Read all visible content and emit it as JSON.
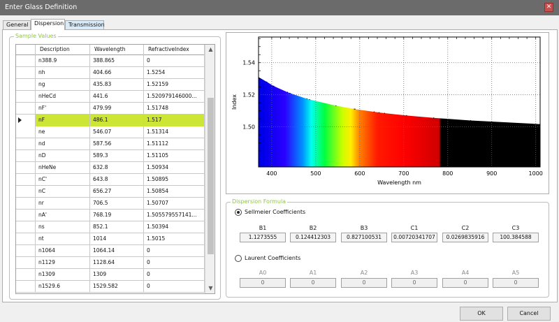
{
  "window": {
    "title": "Enter Glass Definition",
    "close_glyph": "✕"
  },
  "tabs": [
    {
      "label": "General"
    },
    {
      "label": "Dispersion"
    },
    {
      "label": "Transmission"
    }
  ],
  "sample_values": {
    "group_label": "Sample Values",
    "columns": [
      "Description",
      "Wavelength",
      "RefractiveIndex"
    ],
    "rows": [
      [
        "n388.9",
        "388.865",
        "0"
      ],
      [
        "nh",
        "404.66",
        "1.5254"
      ],
      [
        "ng",
        "435.83",
        "1.52159"
      ],
      [
        "nHeCd",
        "441.6",
        "1.520979146000..."
      ],
      [
        "nF'",
        "479.99",
        "1.51748"
      ],
      [
        "nF",
        "486.1",
        "1.517"
      ],
      [
        "ne",
        "546.07",
        "1.51314"
      ],
      [
        "nd",
        "587.56",
        "1.51112"
      ],
      [
        "nD",
        "589.3",
        "1.51105"
      ],
      [
        "nHeNe",
        "632.8",
        "1.50934"
      ],
      [
        "nC'",
        "643.8",
        "1.50895"
      ],
      [
        "nC",
        "656.27",
        "1.50854"
      ],
      [
        "nr",
        "706.5",
        "1.50707"
      ],
      [
        "nA'",
        "768.19",
        "1.505579557141..."
      ],
      [
        "ns",
        "852.1",
        "1.50394"
      ],
      [
        "nt",
        "1014",
        "1.5015"
      ],
      [
        "n1064",
        "1064.14",
        "0"
      ],
      [
        "n1129",
        "1128.64",
        "0"
      ],
      [
        "n1309",
        "1309",
        "0"
      ],
      [
        "n1529.6",
        "1529.582",
        "0"
      ]
    ],
    "selected_row": 5
  },
  "chart_data": {
    "type": "line",
    "xlabel": "Wavelength nm",
    "ylabel": "Index",
    "xlim": [
      370,
      1010
    ],
    "ylim": [
      1.475,
      1.556
    ],
    "xticks": [
      400,
      500,
      600,
      700,
      800,
      900,
      1000
    ],
    "yticks": [
      1.5,
      1.52,
      1.54
    ],
    "xtick_labels": [
      "400",
      "500",
      "600",
      "700",
      "800",
      "900",
      "1000"
    ],
    "ytick_labels": [
      "1.50",
      "1.52",
      "1.54"
    ],
    "grid": true,
    "fill": "visible-spectrum",
    "x": [
      370,
      388.865,
      404.66,
      435.83,
      441.6,
      479.99,
      486.1,
      546.07,
      587.56,
      589.3,
      632.8,
      643.8,
      656.27,
      706.5,
      768.19,
      852.1,
      1010
    ],
    "y": [
      1.531,
      1.528,
      1.5254,
      1.52159,
      1.52098,
      1.51748,
      1.517,
      1.51314,
      1.51112,
      1.51105,
      1.50934,
      1.50895,
      1.50854,
      1.50707,
      1.50558,
      1.50394,
      1.5017
    ]
  },
  "dispersion_formula": {
    "group_label": "Dispersion Formula",
    "sellmeier": {
      "label": "Sellmeier Coefficients",
      "selected": true,
      "names": [
        "B1",
        "B2",
        "B3",
        "C1",
        "C2",
        "C3"
      ],
      "values": [
        "1.1273555",
        "0.124412303",
        "0.827100531",
        "0.00720341707",
        "0.0269835916",
        "100.384588"
      ]
    },
    "laurent": {
      "label": "Laurent Coefficients",
      "selected": false,
      "names": [
        "A0",
        "A1",
        "A2",
        "A3",
        "A4",
        "A5"
      ],
      "values": [
        "0",
        "0",
        "0",
        "0",
        "0",
        "0"
      ]
    }
  },
  "buttons": {
    "ok": "OK",
    "cancel": "Cancel"
  },
  "scroll": {
    "up": "▲",
    "down": "▼"
  }
}
